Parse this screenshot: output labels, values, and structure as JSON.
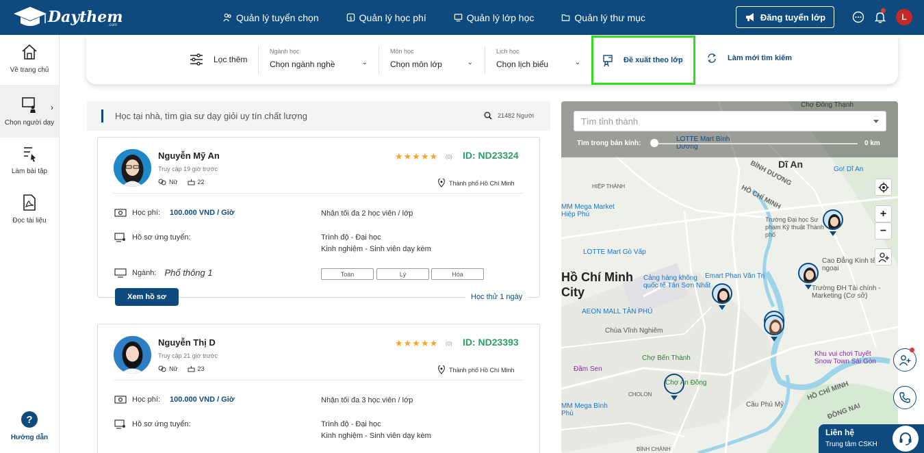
{
  "brand": {
    "name": "Daythem",
    "suffix": ".com"
  },
  "nav": [
    {
      "label": "Quản lý tuyển chọn",
      "icon": "people-icon"
    },
    {
      "label": "Quản lý học phí",
      "icon": "money-icon"
    },
    {
      "label": "Quản lý lớp học",
      "icon": "classroom-icon"
    },
    {
      "label": "Quản lý thư mục",
      "icon": "folder-icon"
    }
  ],
  "header": {
    "post_button": "Đăng tuyển lớp",
    "avatar_letter": "L"
  },
  "sidebar": {
    "items": [
      {
        "label": "Về trang chủ",
        "icon": "home-icon"
      },
      {
        "label": "Chọn người dạy",
        "icon": "teacher-board-icon"
      },
      {
        "label": "Làm bài tập",
        "icon": "exercise-icon"
      },
      {
        "label": "Đọc tài liệu",
        "icon": "pdf-icon"
      }
    ],
    "help": "Hướng dẫn"
  },
  "filters": {
    "more_label": "Lọc thêm",
    "dropdowns": [
      {
        "label": "Ngành học",
        "value": "Chọn ngành nghề"
      },
      {
        "label": "Môn học",
        "value": "Chọn môn lớp"
      },
      {
        "label": "Lịch học",
        "value": "Chọn lịch biểu"
      }
    ],
    "suggest_label": "Đề xuất theo lớp",
    "refresh_label": "Làm mới tìm kiếm"
  },
  "search": {
    "text": "Học tại nhà, tìm gia sư dạy giỏi uy tín chất lượng",
    "count": "21482 Người"
  },
  "tutors": [
    {
      "name": "Nguyễn Mỹ An",
      "access": "Truy cập 19 giờ trước",
      "gender": "Nữ",
      "age": "22",
      "stars": "★★★★★",
      "reviews": "(0)",
      "id": "ID: ND23324",
      "city": "Thành phố Hồ Chí Minh",
      "fee_label": "Học phí:",
      "fee": "100.000 VND / Giờ",
      "capacity": "Nhận tối đa 2 học viên / lớp",
      "profile_label": "Hồ sơ ứng tuyển:",
      "level": "Trình độ - Đại học",
      "experience": "Kinh nghiệm - Sinh viên dạy kèm",
      "major_label": "Ngành:",
      "major": "Phổ thông 1",
      "subjects": [
        "Toán",
        "Lý",
        "Hóa"
      ],
      "view_button": "Xem hồ sơ",
      "trial": "Học thử 1 ngày"
    },
    {
      "name": "Nguyễn Thị D",
      "access": "Truy cập 21 giờ trước",
      "gender": "Nữ",
      "age": "23",
      "stars": "★★★★★",
      "reviews": "(0)",
      "id": "ID: ND23393",
      "city": "Thành phố Hồ Chí Minh",
      "fee_label": "Học phí:",
      "fee": "100.000 VND / Giờ",
      "capacity": "Nhận tối đa 3 học viên / lớp",
      "profile_label": "Hồ sơ ứng tuyển:",
      "level": "Trình độ - Đại học",
      "experience": "Kinh nghiệm - Sinh viên dạy kèm"
    }
  ],
  "map": {
    "city_placeholder": "Tìm tỉnh thành",
    "radius_label": "Tìm trong bán kính:",
    "radius_value": "0 km",
    "labels": {
      "cho_dong_thanh": "Chợ Đông Thạnh",
      "lotte_binh_duong": "LOTTE Mart Bình Dương",
      "di_an": "Dĩ An",
      "go_di_an": "Go! Dĩ An",
      "binh_duong": "BÌNH DƯƠNG",
      "hiep_thanh": "HIỆP THÀNH",
      "ho_chi_minh_1": "HỒ CHÍ MINH",
      "mm_mega": "MM Mega Market Hiệp Phú",
      "hcm_university": "Trường Đại học Sư phạm Kỹ thuật Thành phố",
      "lotte_go_vap": "LOTTE Mart Gò Vấp",
      "ho_chi_minh_city": "Hồ Chí Minh City",
      "emart": "Emart Phan Văn Trị",
      "cang_hang_khong": "Cảng hàng không quốc tế Tân Sơn Nhất",
      "cao_dang": "Cao Đẳng Kinh tế Đối ngoại",
      "dh_tai_chinh": "Trường ĐH Tài chính - Marketing (Cơ sở)",
      "aeon_tan_phu": "AEON MALL TÂN PHÚ",
      "chua_vinh_nghiem": "Chùa Vĩnh Nghiêm",
      "cho_ben_thanh": "Chợ Bến Thành",
      "dam_sen": "Đầm Sen",
      "snow_town": "Khu vui chơi Tuyết Snow Town Sài Gòn",
      "cho_an_dong": "Chợ An Đông",
      "cholon": "CHOLON",
      "mega_binh_phu": "MM Mega Bình Phú",
      "cau_phu_my": "Cầu Phú Mỹ",
      "ho_chi_minh_2": "HỒ CHÍ MINH",
      "dong_nai": "ĐỒNG NAI",
      "binh_chanh": "BÌNH CHÁNH"
    }
  },
  "contact": {
    "title": "Liên hệ",
    "subtitle": "Trung tâm CSKH"
  },
  "colors": {
    "primary": "#0e4a7d",
    "highlight": "#33dd22",
    "id_green": "#2e9d63",
    "star": "#f5a623"
  }
}
